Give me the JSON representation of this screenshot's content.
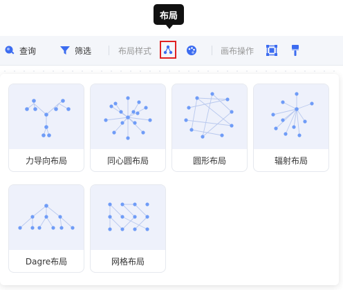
{
  "tooltip": {
    "text": "布局"
  },
  "toolbar": {
    "query": {
      "label": "查询",
      "icon": "search-icon"
    },
    "filter": {
      "label": "筛选",
      "icon": "filter-icon"
    },
    "layout_style": {
      "label": "布局样式"
    },
    "layout_button_icon": "layout-icon",
    "palette_icon": "palette-icon",
    "canvas_ops": {
      "label": "画布操作"
    },
    "fit_icon": "fit-view-icon",
    "brush_icon": "brush-icon"
  },
  "layouts": [
    {
      "label": "力导向布局",
      "icon": "force-layout-icon"
    },
    {
      "label": "同心圆布局",
      "icon": "concentric-layout-icon"
    },
    {
      "label": "圆形布局",
      "icon": "circular-layout-icon"
    },
    {
      "label": "辐射布局",
      "icon": "radial-layout-icon"
    },
    {
      "label": "Dagre布局",
      "icon": "dagre-layout-icon"
    },
    {
      "label": "网格布局",
      "icon": "grid-layout-icon"
    }
  ],
  "colors": {
    "accent": "#3c6cf0",
    "node": "#6f9cf7",
    "edge": "#b8c8ee",
    "highlight": "#e02020"
  }
}
